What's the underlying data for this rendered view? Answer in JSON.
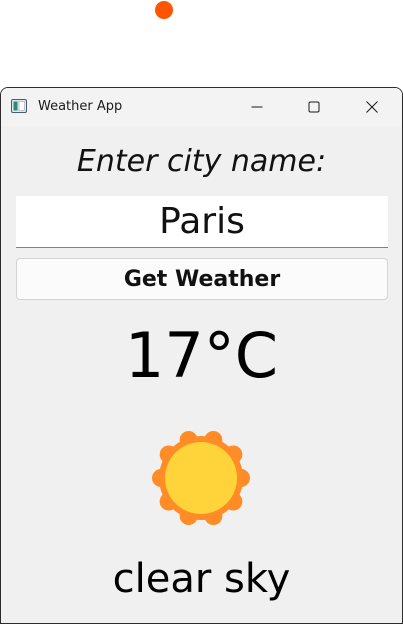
{
  "window": {
    "title": "Weather App",
    "app_icon": "app-window-icon",
    "controls": {
      "minimize_icon": "minimize-icon",
      "maximize_icon": "maximize-icon",
      "close_icon": "close-icon"
    }
  },
  "form": {
    "prompt": "Enter city name:",
    "city_value": "Paris",
    "button_label": "Get Weather"
  },
  "weather": {
    "temperature": "17°C",
    "condition_icon": "sun-icon",
    "description": "clear sky"
  },
  "colors": {
    "cursor_dot": "#ff5500",
    "sun_outer": "#ff8c26",
    "sun_inner": "#ffd43b",
    "window_bg": "#f0f0f0"
  }
}
